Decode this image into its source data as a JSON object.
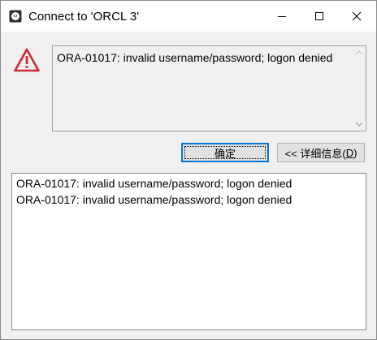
{
  "window": {
    "title": "Connect to 'ORCL 3'"
  },
  "titlebar": {
    "icons": [
      "app-icon",
      "minimize-icon",
      "maximize-icon",
      "close-icon"
    ]
  },
  "message": {
    "icon": "warning-icon",
    "text": "ORA-01017: invalid username/password; logon denied"
  },
  "buttons": {
    "ok_label": "确定",
    "details_prefix": "<< 详细信息(",
    "details_mnemonic": "D",
    "details_suffix": ")"
  },
  "details": {
    "lines": [
      "ORA-01017: invalid username/password; logon denied",
      "ORA-01017: invalid username/password; logon denied"
    ]
  },
  "colors": {
    "warning": "#d0283a",
    "focus_border": "#0078d7"
  }
}
